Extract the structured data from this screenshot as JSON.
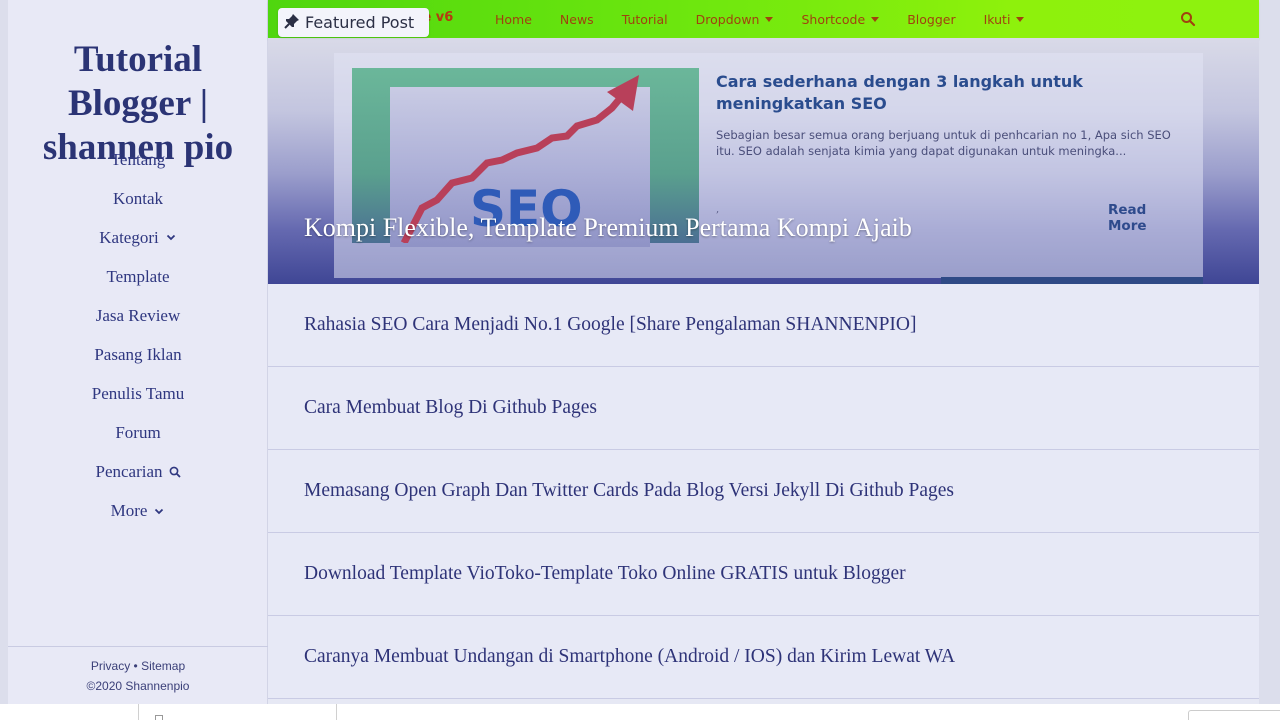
{
  "sidebar": {
    "site_title": "Tutorial Blogger | shannen pio",
    "nav_items": [
      {
        "label": "Tentang",
        "icon": null
      },
      {
        "label": "Kontak",
        "icon": null
      },
      {
        "label": "Kategori",
        "icon": "chevron-down-icon"
      },
      {
        "label": "Template",
        "icon": null
      },
      {
        "label": "Jasa Review",
        "icon": null
      },
      {
        "label": "Pasang Iklan",
        "icon": null
      },
      {
        "label": "Penulis Tamu",
        "icon": null
      },
      {
        "label": "Forum",
        "icon": null
      },
      {
        "label": "Pencarian",
        "icon": "search-icon"
      },
      {
        "label": "More",
        "icon": "chevron-down-icon"
      }
    ],
    "footer": {
      "privacy": "Privacy",
      "separator": "•",
      "sitemap": "Sitemap",
      "copyright": "©2020 Shannenpio"
    }
  },
  "topnav": {
    "brand_partial": "le v6",
    "items": [
      {
        "label": "Home",
        "dropdown": false
      },
      {
        "label": "News",
        "dropdown": false
      },
      {
        "label": "Tutorial",
        "dropdown": false
      },
      {
        "label": "Dropdown",
        "dropdown": true
      },
      {
        "label": "Shortcode",
        "dropdown": true
      },
      {
        "label": "Blogger",
        "dropdown": false
      },
      {
        "label": "Ikuti",
        "dropdown": true
      }
    ],
    "search_icon": "search-icon",
    "colors": {
      "bar_start": "#4fd60f",
      "bar_end": "#8ef20f",
      "link": "#a0420f"
    }
  },
  "featured_badge": {
    "icon": "pin-icon",
    "label": "Featured Post"
  },
  "hero": {
    "featured_title": "Kompi Flexible, Template Premium Pertama Kompi Ajaib",
    "thumbnail_text": "SEO",
    "card": {
      "title": "Cara sederhana dengan 3 langkah untuk meningkatkan SEO",
      "excerpt": "Sebagian besar semua orang berjuang untuk di penhcarian no 1, Apa sich SEO itu. SEO adalah senjata kimia yang dapat digunakan untuk meningka...",
      "dot": ",",
      "read_more": "Read More"
    }
  },
  "posts": [
    "Rahasia SEO Cara Menjadi No.1 Google [Share Pengalaman SHANNENPIO]",
    "Cara Membuat Blog Di Github Pages",
    "Memasang Open Graph Dan Twitter Cards Pada Blog Versi Jekyll Di Github Pages",
    "Download Template VioToko-Template Toko Online GRATIS untuk Blogger",
    "Caranya Membuat Undangan di Smartphone (Android / IOS) dan Kirim Lewat WA"
  ]
}
